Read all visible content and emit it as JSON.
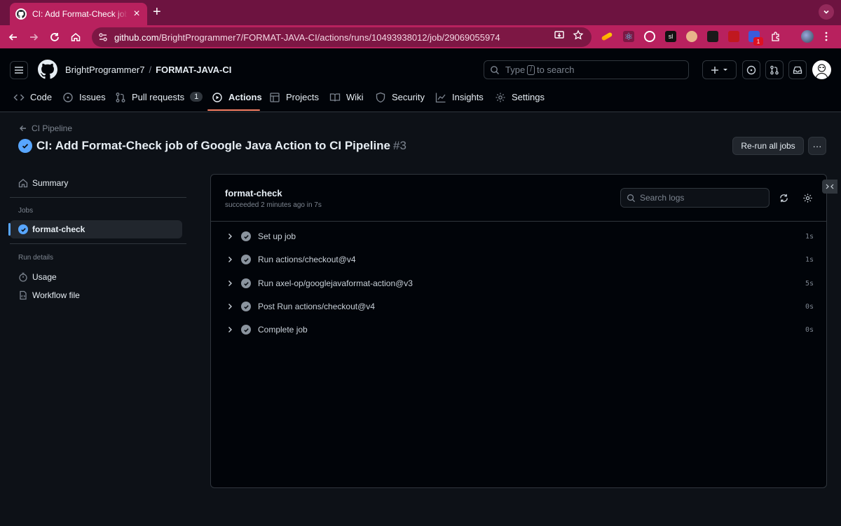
{
  "browser": {
    "tab_title": "CI: Add Format-Check job of Google Java Action to CI Pipeline",
    "tab_close": "×",
    "new_tab": "+",
    "url_host": "github.com",
    "url_path": "/BrightProgrammer7/FORMAT-JAVA-CI/actions/runs/10493938012/job/29069055974",
    "extension_badge": "1"
  },
  "header": {
    "owner": "BrightProgrammer7",
    "separator": "/",
    "repo": "FORMAT-JAVA-CI",
    "search_prefix": "Type",
    "search_key": "/",
    "search_suffix": "to search"
  },
  "repo_nav": {
    "items": [
      {
        "label": "Code",
        "icon": "code-icon"
      },
      {
        "label": "Issues",
        "icon": "issue-icon"
      },
      {
        "label": "Pull requests",
        "icon": "pull-request-icon",
        "counter": "1"
      },
      {
        "label": "Actions",
        "icon": "play-icon",
        "active": true
      },
      {
        "label": "Projects",
        "icon": "table-icon"
      },
      {
        "label": "Wiki",
        "icon": "book-icon"
      },
      {
        "label": "Security",
        "icon": "shield-icon"
      },
      {
        "label": "Insights",
        "icon": "graph-icon"
      },
      {
        "label": "Settings",
        "icon": "gear-icon"
      }
    ]
  },
  "run": {
    "back_label": "CI Pipeline",
    "title": "CI: Add Format-Check job of Google Java Action to CI Pipeline",
    "number": "#3",
    "rerun_label": "Re-run all jobs",
    "more_label": "···"
  },
  "sidebar": {
    "summary_label": "Summary",
    "jobs_heading": "Jobs",
    "job_label": "format-check",
    "run_details_heading": "Run details",
    "usage_label": "Usage",
    "workflow_label": "Workflow file"
  },
  "job": {
    "name": "format-check",
    "status": "succeeded 2 minutes ago in 7s",
    "search_placeholder": "Search logs",
    "steps": [
      {
        "name": "Set up job",
        "duration": "1s"
      },
      {
        "name": "Run actions/checkout@v4",
        "duration": "1s"
      },
      {
        "name": "Run axel-op/googlejavaformat-action@v3",
        "duration": "5s"
      },
      {
        "name": "Post Run actions/checkout@v4",
        "duration": "0s"
      },
      {
        "name": "Complete job",
        "duration": "0s"
      }
    ]
  },
  "colors": {
    "browser_accent": "#b8215e",
    "browser_tabstrip": "#6d1340",
    "success_blue": "#58a6ff",
    "nav_underline": "#f78166",
    "background": "#0d1117"
  }
}
